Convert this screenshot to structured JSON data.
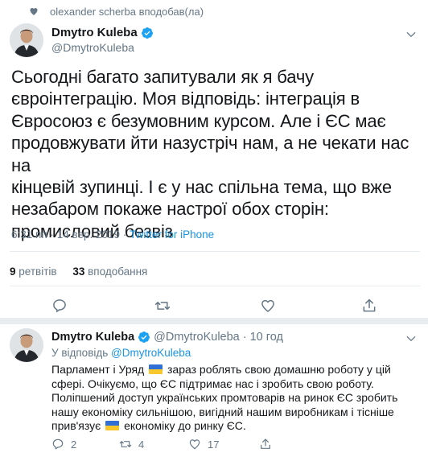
{
  "context": {
    "text": "olexander scherba вподобав(ла)"
  },
  "tweet": {
    "author_name": "Dmytro Kuleba",
    "author_handle": "@DmytroKuleba",
    "lines": [
      "Сьогодні багато запитували як я бачу",
      "євроінтеграцію. Моя відповідь: інтеграція в",
      "Євросоюз є безумовним курсом. Але і ЄС має",
      "продовжувати йти назустріч нам, а не чекати нас на",
      "кінцевій зупинці. І є у нас спільна тема, що вже",
      "незабаром покаже настрої обох сторін:",
      "промисловий безвіз"
    ],
    "time": "6:31 пп",
    "date": "14 вер. 2019",
    "separator": "·",
    "source": "Twitter for iPhone",
    "retweets_count": "9",
    "retweets_label": "ретвітів",
    "likes_count": "33",
    "likes_label": "вподобання"
  },
  "reply": {
    "author_name": "Dmytro Kuleba",
    "author_handle": "@DmytroKuleba",
    "separator": "·",
    "age": "10 год",
    "replying_prefix": "У відповідь",
    "replying_handle": "@DmytroKuleba",
    "text_part1": "Парламент і Уряд",
    "text_part2": "зараз роблять свою домашню роботу у цій сфері. Очікуємо, що ЄС підтримає нас і зробить свою роботу. Поліпшений доступ українських промтоварів на ринок ЄС зробить нашу економіку сильнішою, вигідний нашим виробникам і тісніше прив'язує",
    "text_part3": "економіку до ринку ЄС.",
    "reply_count": "2",
    "retweet_count": "4",
    "like_count": "17"
  },
  "icons": {
    "context": "heart-icon",
    "verified": "verified-badge-icon",
    "menu": "chevron-down-icon",
    "reply": "reply-icon",
    "retweet": "retweet-icon",
    "like": "heart-icon",
    "share": "share-icon",
    "flag": "ukraine-flag-emoji"
  },
  "colors": {
    "accent": "#1b95e0",
    "muted": "#657786",
    "text": "#14171a",
    "divider": "#e6ecf0",
    "flag_blue": "#2f6fd6",
    "flag_yellow": "#f7c72b"
  }
}
